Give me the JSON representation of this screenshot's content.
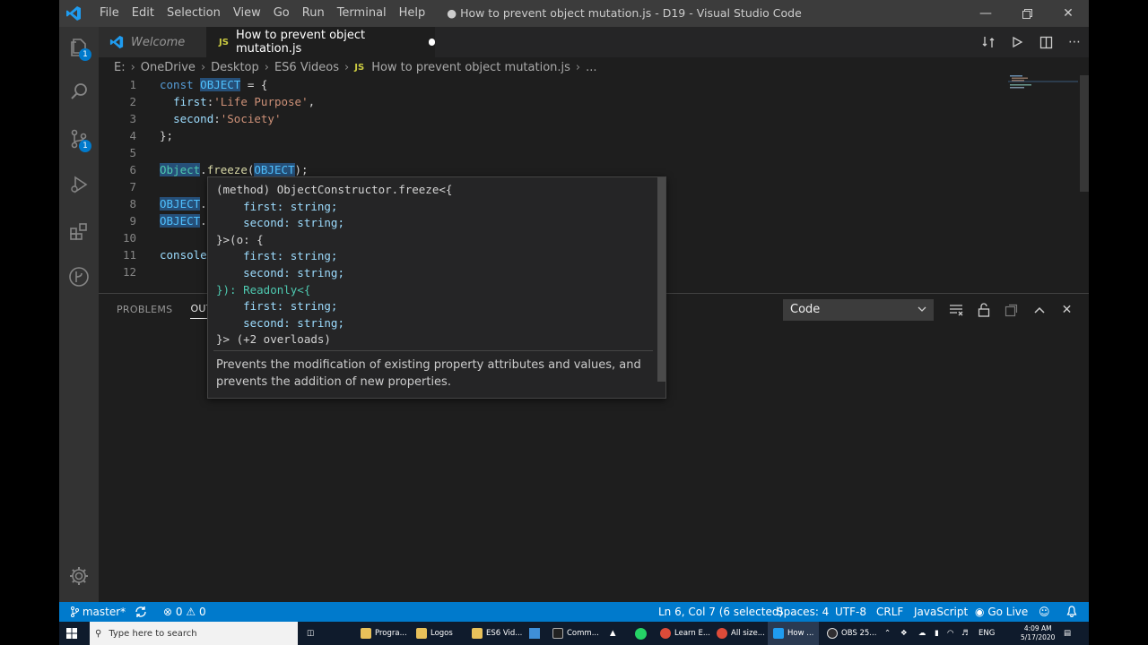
{
  "window": {
    "menu": [
      "File",
      "Edit",
      "Selection",
      "View",
      "Go",
      "Run",
      "Terminal",
      "Help"
    ],
    "title": "● How to prevent object mutation.js - D19 - Visual Studio Code",
    "controls": [
      "minimize",
      "restore",
      "close"
    ]
  },
  "activity_bar": {
    "items": [
      {
        "name": "explorer",
        "badge": "1"
      },
      {
        "name": "search"
      },
      {
        "name": "source-control",
        "badge": "1"
      },
      {
        "name": "run-debug"
      },
      {
        "name": "extensions"
      },
      {
        "name": "git-graph"
      }
    ]
  },
  "tabs": [
    {
      "label": "Welcome",
      "active": false
    },
    {
      "label": "How to prevent object mutation.js",
      "active": true,
      "modified": true
    }
  ],
  "breadcrumb": [
    "E:",
    "OneDrive",
    "Desktop",
    "ES6 Videos",
    "How to prevent object mutation.js",
    "..."
  ],
  "code": {
    "line_numbers": [
      "1",
      "2",
      "3",
      "4",
      "5",
      "6",
      "7",
      "8",
      "9",
      "10",
      "11",
      "12"
    ],
    "l1": {
      "kw": "const",
      "var": "OBJECT",
      "rest": " = {"
    },
    "l2": {
      "prop": "first",
      "colon": ":",
      "str": "'Life Purpose'",
      "rest": ","
    },
    "l3": {
      "prop": "second",
      "colon": ":",
      "str": "'Society'"
    },
    "l4": "};",
    "l6": {
      "cls": "Object",
      "dot": ".",
      "fn": "freeze",
      "open": "(",
      "var": "OBJECT",
      "close": ");"
    },
    "l8": {
      "var": "OBJECT",
      "rest": "."
    },
    "l9": {
      "var": "OBJECT",
      "rest": "."
    },
    "l11": {
      "var": "console"
    }
  },
  "hover": {
    "signature": [
      "(method) ObjectConstructor.freeze<{",
      "    first: string;",
      "    second: string;",
      "}>(o: {",
      "    first: string;",
      "    second: string;",
      "}): Readonly<{",
      "    first: string;",
      "    second: string;",
      "}> (+2 overloads)"
    ],
    "description": "Prevents the modification of existing property attributes and values, and prevents the addition of new properties."
  },
  "panel": {
    "tabs": [
      "PROBLEMS",
      "OUTPUT"
    ],
    "active_tab": "OUTPUT",
    "output_channel": "Code",
    "actions": [
      "clear-output",
      "lock-scroll",
      "open-in-editor",
      "maximize-panel",
      "close-panel"
    ]
  },
  "status_bar": {
    "branch": "master*",
    "errors": "0",
    "warnings": "0",
    "position": "Ln 6, Col 7 (6 selected)",
    "spaces": "Spaces: 4",
    "encoding": "UTF-8",
    "eol": "CRLF",
    "language": "JavaScript",
    "golive": "Go Live"
  },
  "taskbar": {
    "search_placeholder": "Type here to search",
    "apps": [
      "Progra...",
      "Logos",
      "ES6 Vid...",
      "Comm...",
      "Learn E...",
      "All size...",
      "How ...",
      "OBS 25..."
    ],
    "language": "ENG",
    "time": "4:09 AM",
    "date": "5/17/2020"
  },
  "colors": {
    "accent": "#007acc",
    "editor_bg": "#1e1e1e",
    "activity_bg": "#333333",
    "keyword": "#569cd6",
    "string": "#ce9178",
    "type": "#4ec9b0"
  }
}
